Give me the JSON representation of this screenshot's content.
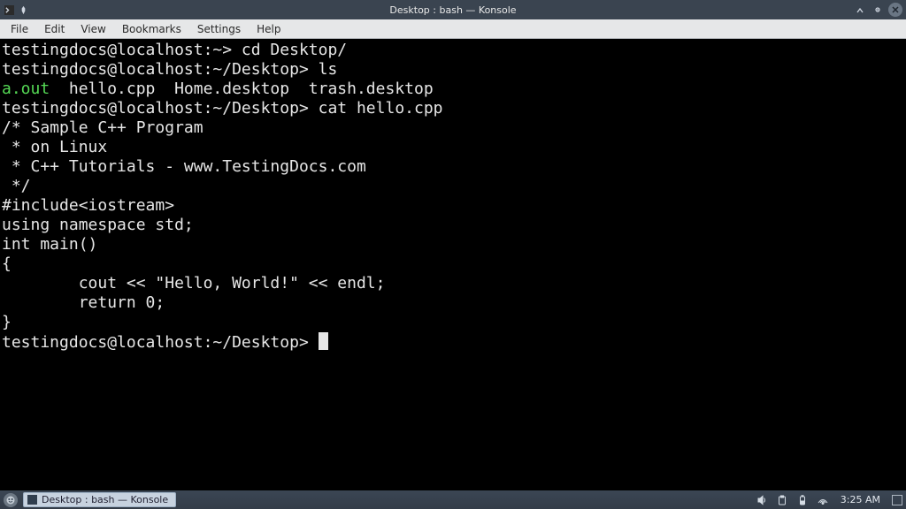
{
  "titlebar": {
    "title": "Desktop : bash — Konsole"
  },
  "menubar": {
    "items": [
      "File",
      "Edit",
      "View",
      "Bookmarks",
      "Settings",
      "Help"
    ]
  },
  "terminal": {
    "lines": [
      {
        "segments": [
          {
            "t": "testingdocs@localhost:~> cd Desktop/"
          }
        ]
      },
      {
        "segments": [
          {
            "t": "testingdocs@localhost:~/Desktop> ls"
          }
        ]
      },
      {
        "segments": [
          {
            "t": "a.out",
            "cls": "green"
          },
          {
            "t": "  hello.cpp  Home.desktop  trash.desktop"
          }
        ]
      },
      {
        "segments": [
          {
            "t": "testingdocs@localhost:~/Desktop> cat hello.cpp"
          }
        ]
      },
      {
        "segments": [
          {
            "t": "/* Sample C++ Program"
          }
        ]
      },
      {
        "segments": [
          {
            "t": " * on Linux"
          }
        ]
      },
      {
        "segments": [
          {
            "t": " * C++ Tutorials - www.TestingDocs.com"
          }
        ]
      },
      {
        "segments": [
          {
            "t": " */"
          }
        ]
      },
      {
        "segments": [
          {
            "t": ""
          }
        ]
      },
      {
        "segments": [
          {
            "t": "#include<iostream>"
          }
        ]
      },
      {
        "segments": [
          {
            "t": "using namespace std;"
          }
        ]
      },
      {
        "segments": [
          {
            "t": ""
          }
        ]
      },
      {
        "segments": [
          {
            "t": "int main()"
          }
        ]
      },
      {
        "segments": [
          {
            "t": "{"
          }
        ]
      },
      {
        "segments": [
          {
            "t": "        cout << \"Hello, World!\" << endl;"
          }
        ]
      },
      {
        "segments": [
          {
            "t": "        return 0;"
          }
        ]
      },
      {
        "segments": [
          {
            "t": "}"
          }
        ]
      },
      {
        "segments": [
          {
            "t": "testingdocs@localhost:~/Desktop> "
          }
        ],
        "cursor": true
      }
    ]
  },
  "taskbar": {
    "task_label": "Desktop : bash — Konsole",
    "clock": "3:25 AM"
  }
}
